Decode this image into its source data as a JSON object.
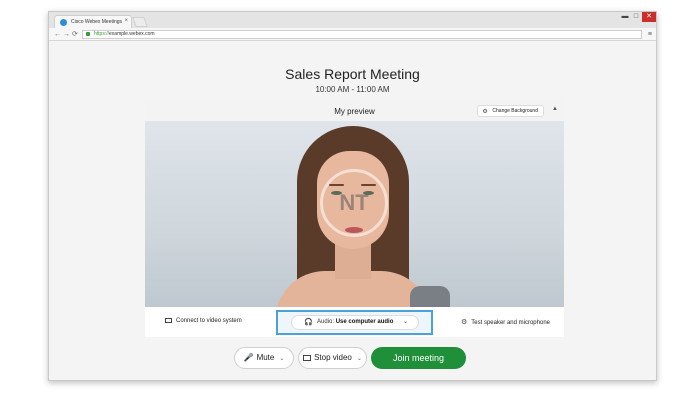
{
  "browser": {
    "tab_title": "Cisco Webex Meetings",
    "tab_close": "×",
    "url_scheme": "https://",
    "url_rest": "example.webex.com",
    "window_controls": {
      "minimize": "▬",
      "maximize": "□",
      "close": "✕"
    },
    "nav": {
      "back": "←",
      "forward": "→",
      "reload": "⟳"
    },
    "menu_glyph": "≡"
  },
  "meeting": {
    "title": "Sales Report Meeting",
    "time": "10:00 AM - 11:00 AM"
  },
  "preview": {
    "title": "My preview",
    "change_background": "Change Background",
    "change_background_glyph": "⚙",
    "collapse_glyph": "▲",
    "watermark": "NT"
  },
  "options": {
    "connect_video": "Connect to video system",
    "audio_label": "Audio:",
    "audio_value": "Use computer audio",
    "audio_caret": "⌄",
    "audio_glyph": "🎧",
    "test_audio": "Test speaker and microphone",
    "test_glyph": "⚙"
  },
  "buttons": {
    "mute": "Mute",
    "mute_glyph": "🎤",
    "stop_video": "Stop video",
    "join": "Join meeting",
    "caret": "⌄"
  },
  "colors": {
    "join": "#1f8f3a",
    "audio_highlight": "#4aa3d8",
    "close_button": "#c9302c"
  }
}
